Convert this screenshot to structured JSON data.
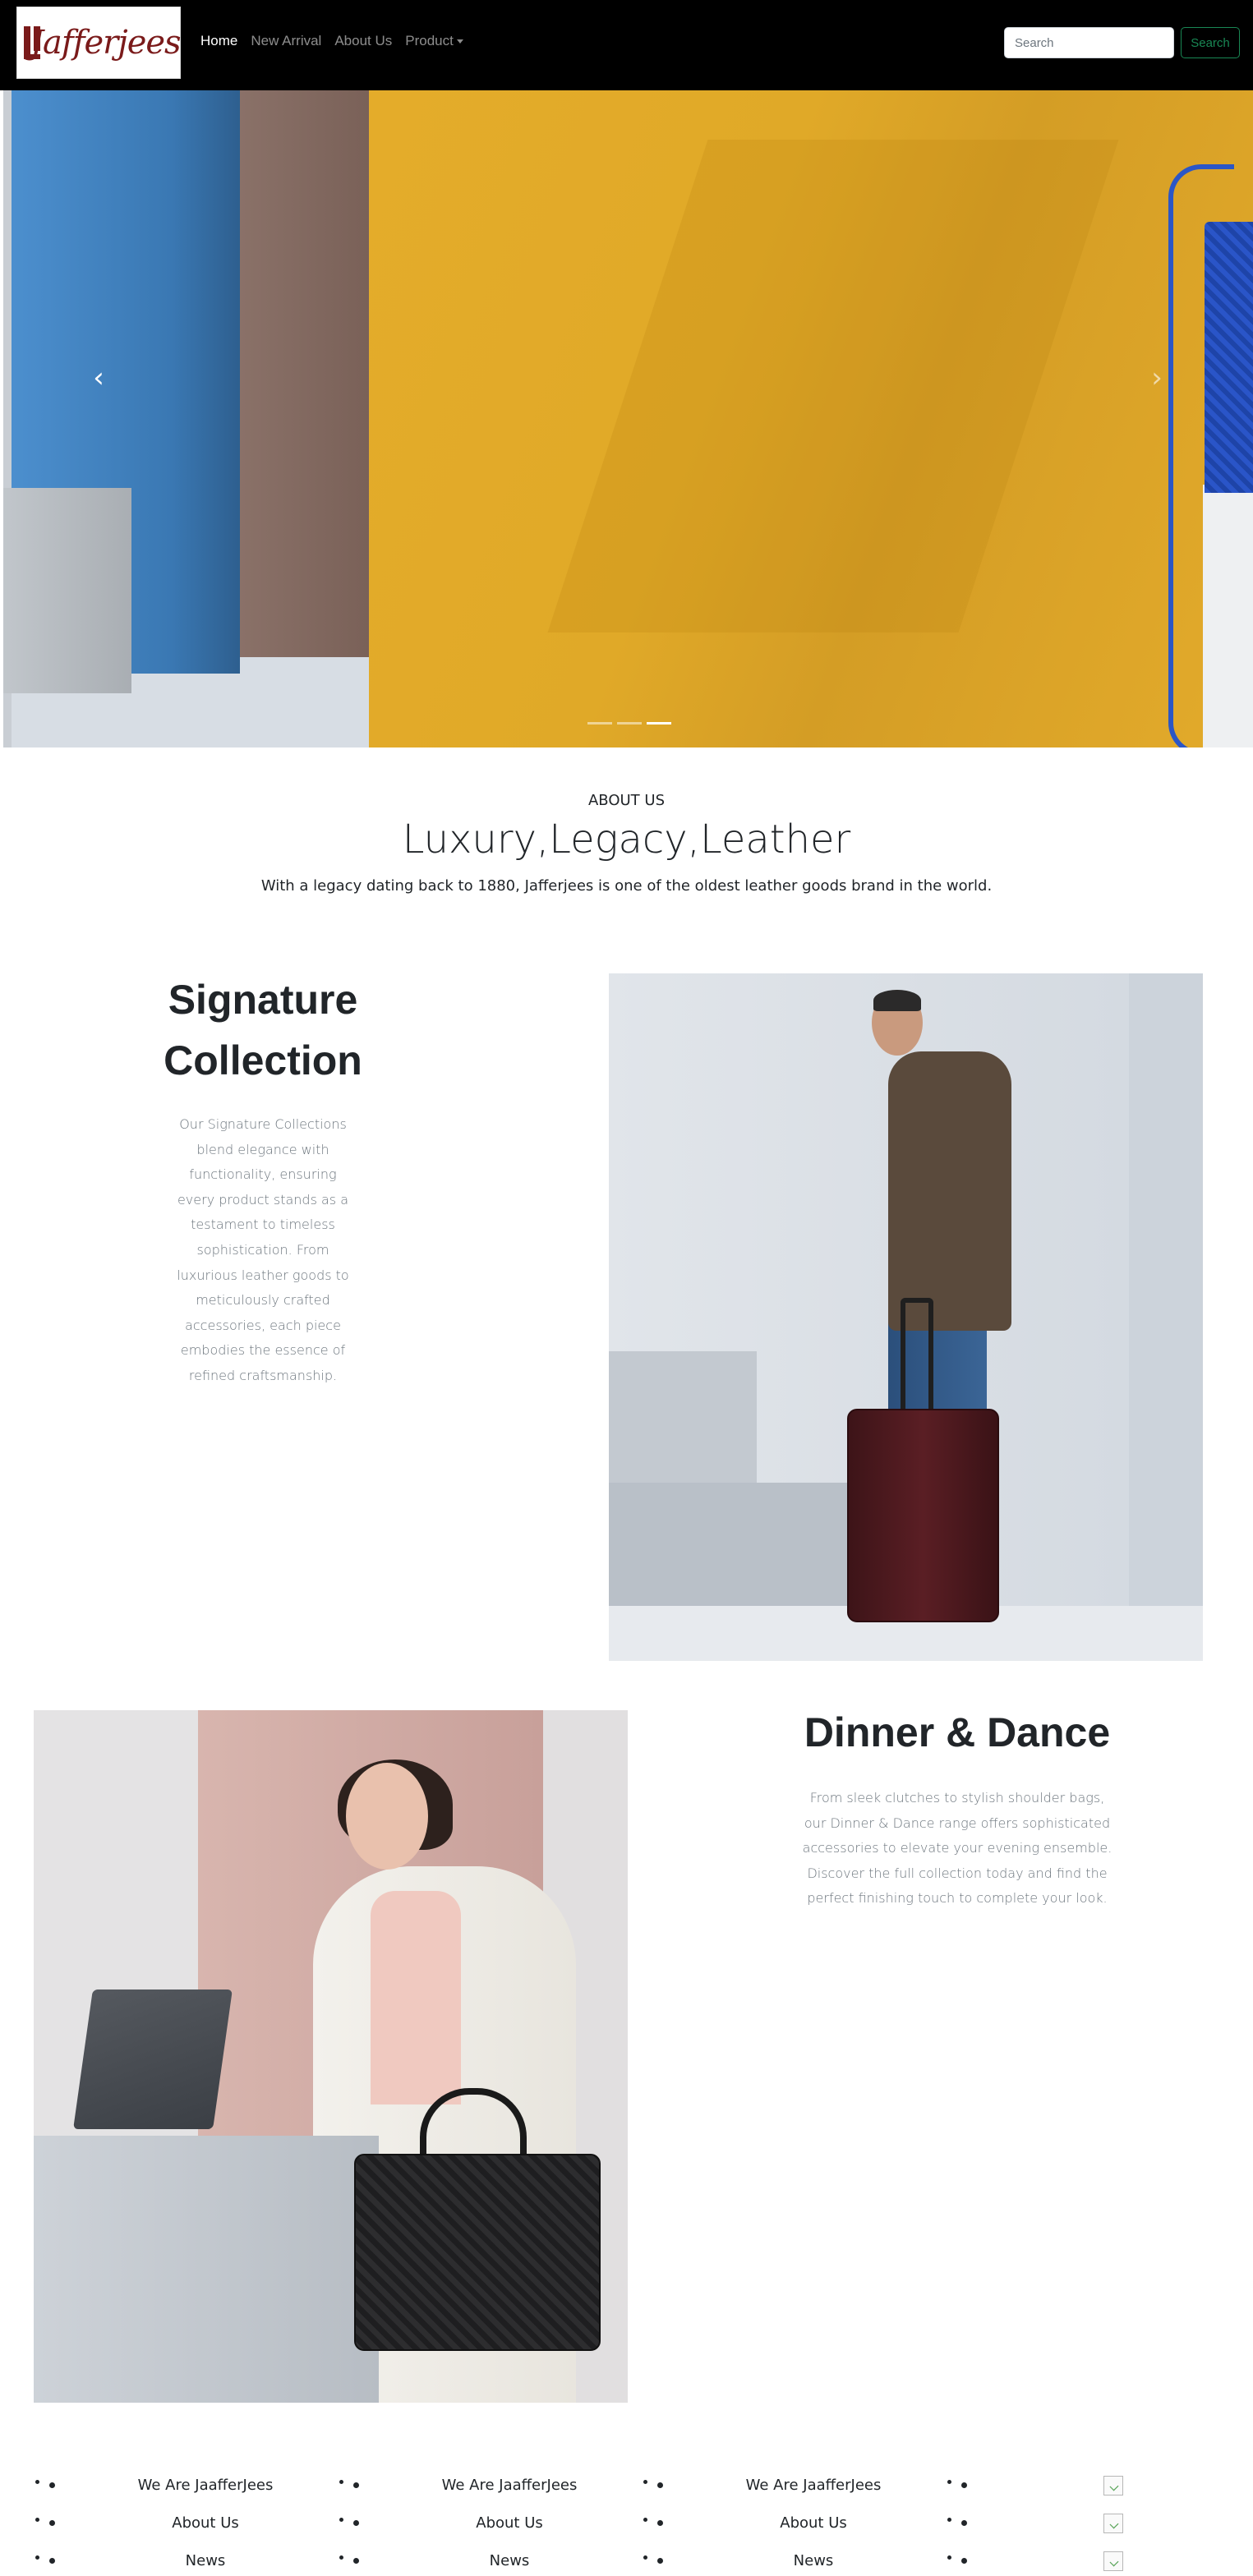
{
  "navbar": {
    "brand_text": "Jafferjees",
    "links": [
      {
        "label": "Home",
        "active": true
      },
      {
        "label": "New Arrival",
        "active": false
      },
      {
        "label": "About Us",
        "active": false
      },
      {
        "label": "Product",
        "active": false,
        "dropdown": true
      }
    ],
    "search_placeholder": "Search",
    "search_button": "Search",
    "search_button_color": "#198754"
  },
  "carousel": {
    "prev_icon": "chevron-left-icon",
    "next_icon": "chevron-right-icon",
    "prev_glyph": "‹",
    "next_glyph": "›",
    "slide_count": 3,
    "active_slide": 3
  },
  "about": {
    "eyebrow": "ABOUT US",
    "title": "Luxury,Legacy,Leather",
    "subtitle": "With a legacy dating back to 1880, Jafferjees is one of the oldest leather goods brand in the world."
  },
  "signature": {
    "title_line1": "Signature",
    "title_line2": "Collection",
    "body": "Our Signature Collections blend elegance with functionality, ensuring every product stands as a testament to timeless sophistication. From luxurious leather goods to meticulously crafted accessories, each piece embodies the essence of refined craftsmanship."
  },
  "dinner": {
    "title": "Dinner & Dance",
    "body": "From sleek clutches to stylish shoulder bags, our Dinner & Dance range offers sophisticated accessories to elevate your evening ensemble. Discover the full collection today and find the perfect finishing touch to complete your look."
  },
  "footer": {
    "columns": [
      {
        "items": [
          "We Are JaafferJees",
          "About Us",
          "News"
        ]
      },
      {
        "items": [
          "We Are JaafferJees",
          "About Us",
          "News"
        ]
      },
      {
        "items": [
          "We Are JaafferJees",
          "About Us",
          "News"
        ]
      },
      {
        "items": [
          "broken-image-icon",
          "broken-image-icon",
          "broken-image-icon"
        ]
      }
    ]
  },
  "colors": {
    "brand": "#7a1a1a",
    "navbar_bg": "#000000",
    "accent_green": "#198754"
  }
}
